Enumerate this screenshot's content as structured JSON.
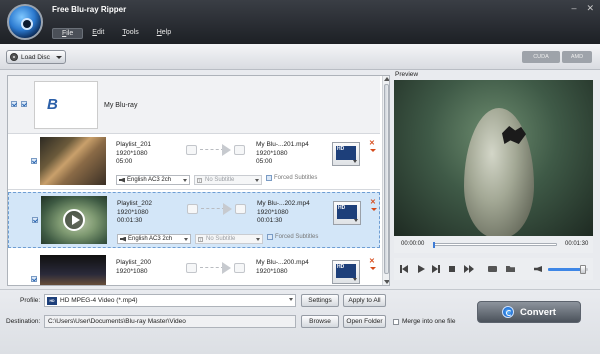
{
  "window": {
    "title": "Free Blu-ray Ripper",
    "controls": [
      "–",
      "✕"
    ]
  },
  "menu": [
    "File",
    "Edit",
    "Tools",
    "Help"
  ],
  "toolbar": {
    "load_disc": "Load Disc",
    "cuda": "CUDA",
    "amd": "AMD"
  },
  "disc": {
    "name": "My Blu-ray",
    "logo_text": "B"
  },
  "titles": [
    {
      "playlist": "Playlist_201",
      "resolution": "1920*1080",
      "duration": "05:00",
      "output_name": "My Blu-...201.mp4",
      "output_resolution": "1920*1080",
      "output_duration": "05:00",
      "audio": "English AC3 2ch",
      "subtitle": "No Subtitle",
      "forced": "Forced Subtitles"
    },
    {
      "playlist": "Playlist_202",
      "resolution": "1920*1080",
      "duration": "00:01:30",
      "output_name": "My Blu-...202.mp4",
      "output_resolution": "1920*1080",
      "output_duration": "00:01:30",
      "audio": "English AC3 2ch",
      "subtitle": "No Subtitle",
      "forced": "Forced Subtitles"
    },
    {
      "playlist": "Playlist_200",
      "resolution": "1920*1080",
      "duration": "",
      "output_name": "My Blu-...200.mp4",
      "output_resolution": "1920*1080",
      "output_duration": "",
      "audio": "",
      "subtitle": "",
      "forced": ""
    }
  ],
  "preview": {
    "label": "Preview",
    "time_current": "00:00:00",
    "time_total": "00:01:30",
    "seek_progress": 0.0,
    "volume_level": 0.8
  },
  "bottom": {
    "profile_label": "Profile:",
    "profile_value": "HD MPEG-4 Video (*.mp4)",
    "settings": "Settings",
    "apply_all": "Apply to All",
    "destination_label": "Destination:",
    "destination_value": "C:\\Users\\User\\Documents\\Blu-ray Master\\Video",
    "browse": "Browse",
    "open_folder": "Open Folder",
    "merge": "Merge into one file",
    "convert": "Convert"
  },
  "colors": {
    "accent": "#3d7bd6",
    "selection": "#d3e6f8",
    "remove": "#d64a1a"
  }
}
